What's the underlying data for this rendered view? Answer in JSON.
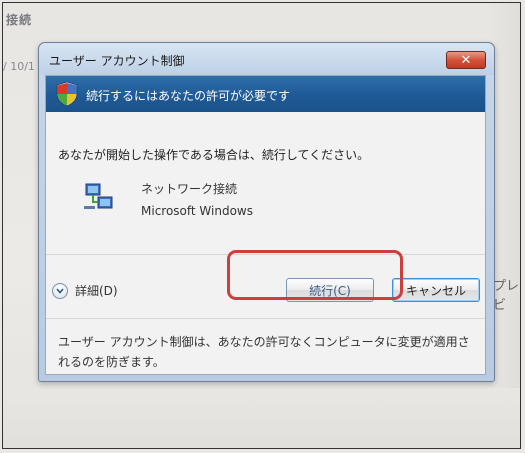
{
  "background": {
    "title_fragment": "接続",
    "date_fragment": "/ 10/1",
    "right_fragment": "プレビ"
  },
  "dialog": {
    "title": "ユーザー アカウント制御",
    "close_symbol": "✕",
    "banner_text": "続行するにはあなたの許可が必要です",
    "message": "あなたが開始した操作である場合は、続行してください。",
    "program_name": "ネットワーク接続",
    "publisher": "Microsoft Windows",
    "details_label": "詳細(D)",
    "continue_label": "続行(C)",
    "cancel_label": "キャンセル",
    "footer": "ユーザー アカウント制御は、あなたの許可なくコンピュータに変更が適用されるのを防ぎます。"
  },
  "icons": {
    "shield": "uac-shield-icon",
    "program": "network-connections-icon",
    "details": "chevron-down-icon"
  },
  "colors": {
    "banner": "#1f5a96",
    "close": "#c23a22",
    "highlight": "#c9403e"
  }
}
